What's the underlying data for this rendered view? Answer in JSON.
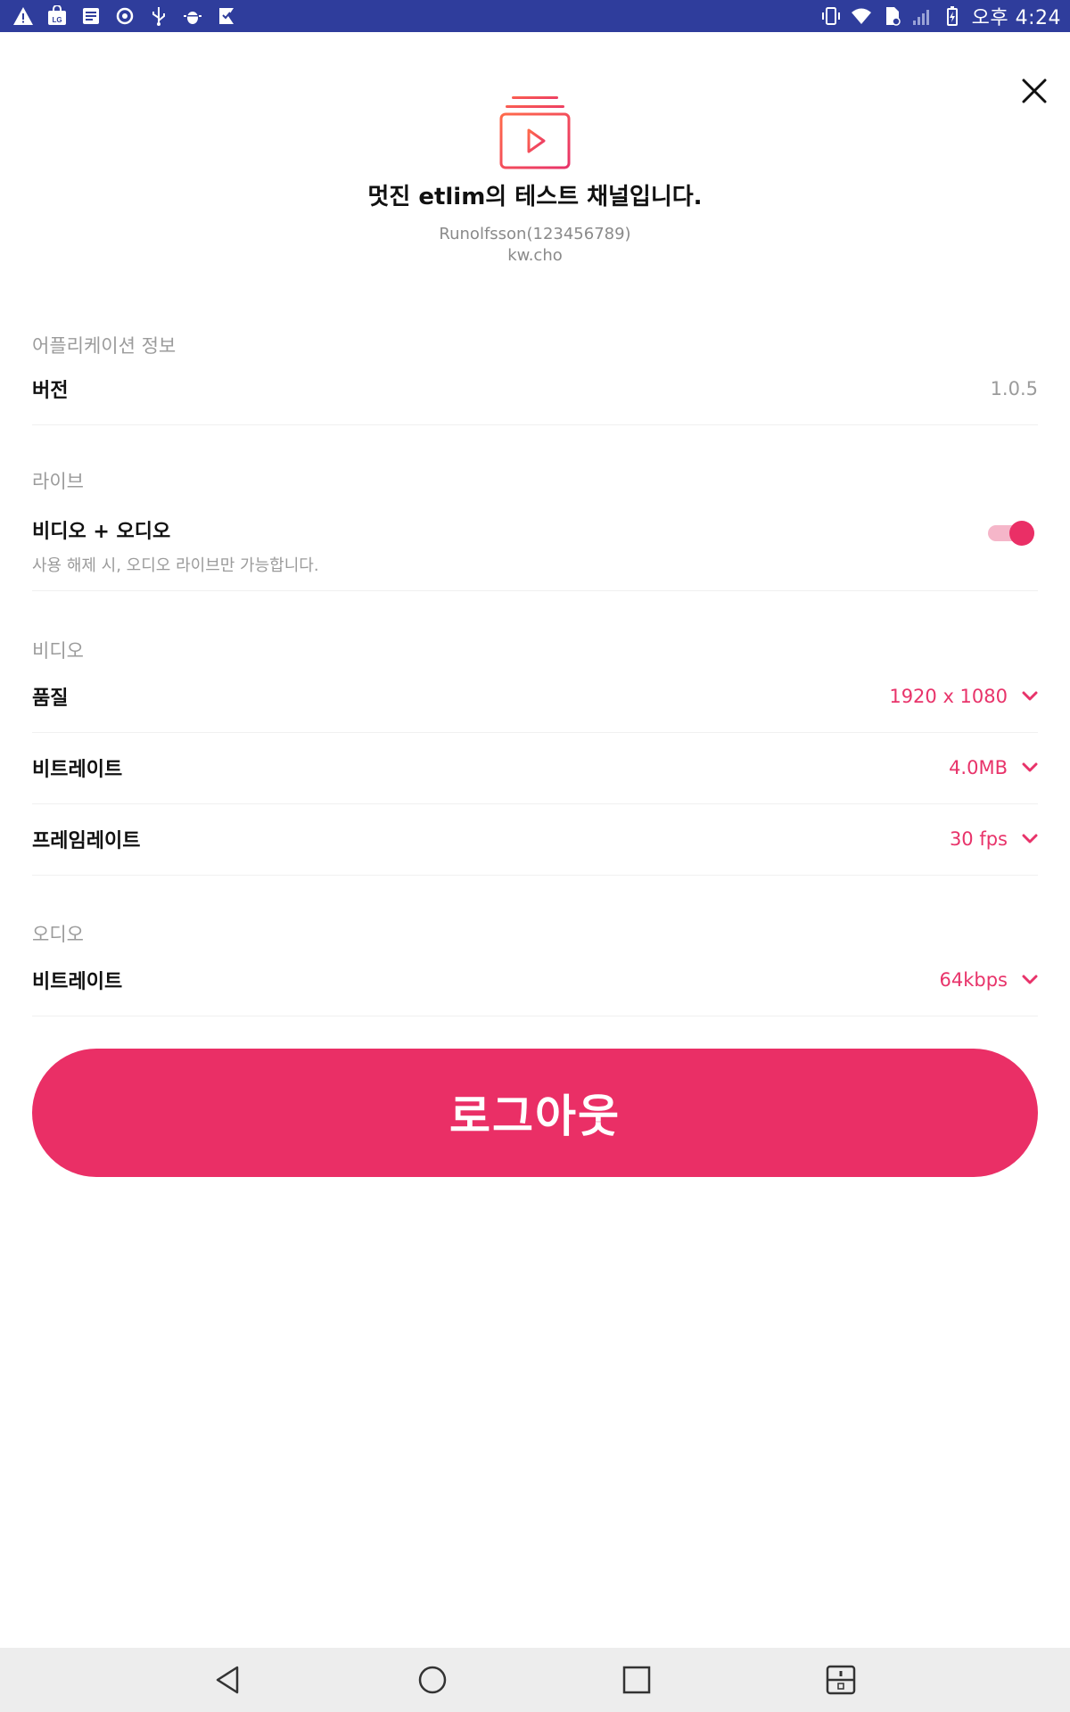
{
  "status_bar": {
    "time": "오후 4:24",
    "left_icons": [
      "warning-icon",
      "lg-store-icon",
      "document-icon",
      "sync-icon",
      "usb-icon",
      "android-debug-icon",
      "bookmark-check-icon"
    ],
    "right_icons": [
      "vibrate-icon",
      "wifi-icon",
      "sim-icon",
      "signal-icon",
      "battery-icon"
    ]
  },
  "header": {
    "channel_name": "멋진 etlim의 테스트 채널입니다.",
    "account_line": "Runolfsson(123456789)",
    "user_id": "kw.cho",
    "icon": "video-channel-icon"
  },
  "sections": {
    "app_info": {
      "title": "어플리케이션 정보",
      "version_label": "버전",
      "version_value": "1.0.5"
    },
    "live": {
      "title": "라이브",
      "video_audio_label": "비디오 + 오디오",
      "video_audio_hint": "사용 해제 시, 오디오 라이브만 가능합니다.",
      "video_audio_enabled": true
    },
    "video": {
      "title": "비디오",
      "quality_label": "품질",
      "quality_value": "1920 x 1080",
      "bitrate_label": "비트레이트",
      "bitrate_value": "4.0MB",
      "framerate_label": "프레임레이트",
      "framerate_value": "30 fps"
    },
    "audio": {
      "title": "오디오",
      "bitrate_label": "비트레이트",
      "bitrate_value": "64kbps"
    }
  },
  "logout": {
    "label": "로그아웃"
  },
  "colors": {
    "accent": "#ea2f66",
    "status_bar": "#2f3d9c",
    "muted": "#9b9b9b"
  },
  "nav": [
    "back-icon",
    "home-icon",
    "recents-icon",
    "split-screen-icon"
  ]
}
